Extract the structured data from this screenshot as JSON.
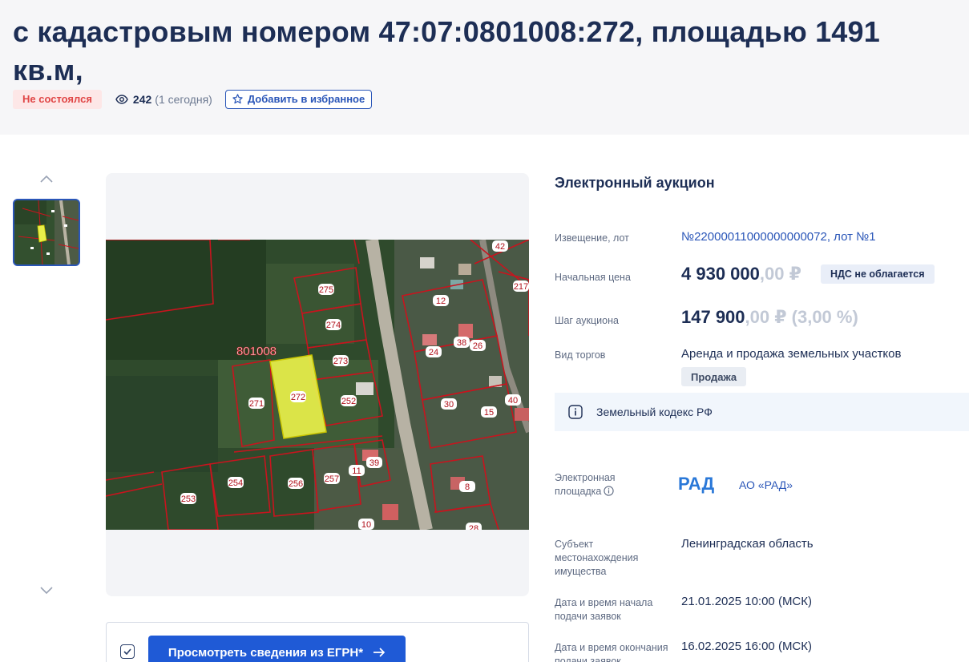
{
  "header": {
    "title": "с кадастровым номером 47:07:0801008:272, площадью 1491 кв.м,",
    "status": "Не состоялся",
    "views_count": "242",
    "views_today": "(1 сегодня)",
    "favorite_label": "Добавить в избранное"
  },
  "gallery": {
    "map_labels": [
      "42",
      "275",
      "217",
      "12",
      "274",
      "38",
      "26",
      "801008",
      "24",
      "273",
      "272",
      "271",
      "252",
      "30",
      "40",
      "15",
      "254",
      "256",
      "257",
      "11",
      "39",
      "253",
      "8",
      "10",
      "28"
    ]
  },
  "egrn": {
    "button_label": "Просмотреть сведения из ЕГРН*"
  },
  "auction": {
    "type": "Электронный аукцион",
    "notice_label": "Извещение, лот",
    "notice_value": "№22000011000000000072, лот №1",
    "start_price_label": "Начальная цена",
    "start_price_int": "4 930 000",
    "start_price_frac": ",00 ₽",
    "nds": "НДС не облагается",
    "step_label": "Шаг аукциона",
    "step_int": "147 900",
    "step_frac": ",00 ₽ (3,00 %)",
    "trade_kind_label": "Вид торгов",
    "trade_kind_value": "Аренда и продажа земельных участков",
    "sale_pill": "Продажа",
    "code": "Земельный кодекс РФ",
    "platform_label": "Электронная площадка",
    "platform_logo": "РАД",
    "platform_name": "АО «РАД»",
    "subject_label": "Субъект местонахождения имущества",
    "subject_value": "Ленинградская область",
    "apps_start_label": "Дата и время начала подачи заявок",
    "apps_start_value": "21.01.2025 10:00 (МСК)",
    "apps_end_label": "Дата и время окончания подачи заявок",
    "apps_end_value": "16.02.2025 16:00 (МСК)"
  },
  "colors": {
    "brand_blue": "#1f5ad6",
    "title_navy": "#1d2e55",
    "status_red": "#e04646",
    "status_bg": "#fde7e7",
    "parcel_yellow": "#e8f04a"
  }
}
